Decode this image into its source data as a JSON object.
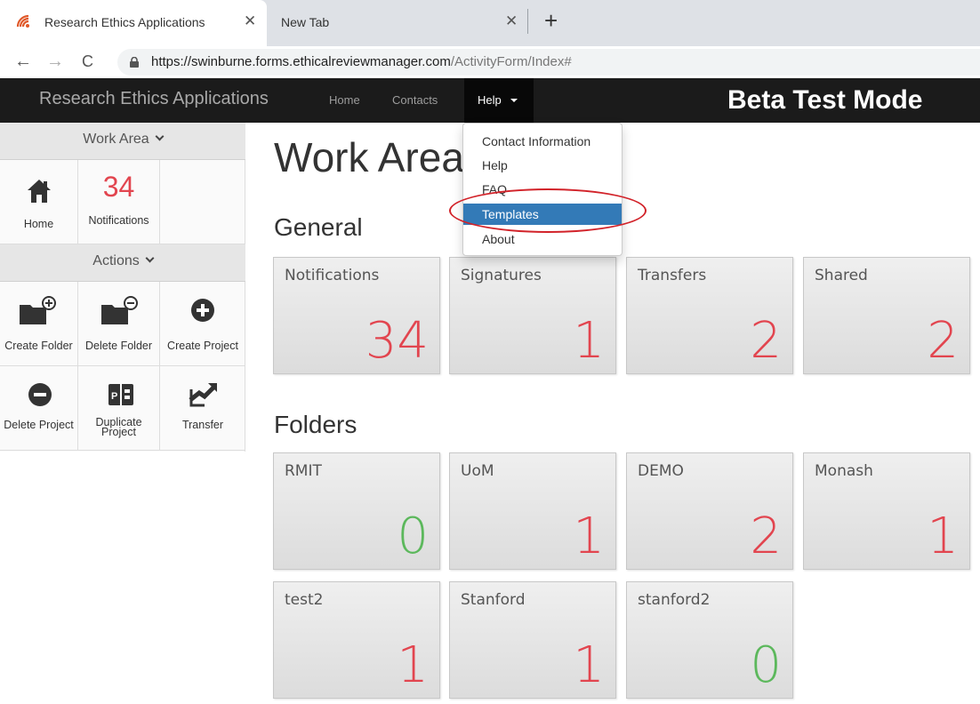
{
  "browser": {
    "tabs": [
      {
        "title": "Research Ethics Applications",
        "active": true
      },
      {
        "title": "New Tab",
        "active": false
      }
    ],
    "close_glyph": "✕",
    "new_tab_glyph": "+",
    "nav": {
      "back": "←",
      "forward": "→",
      "reload": "C"
    },
    "url_domain": "https://swinburne.forms.ethicalreviewmanager.com",
    "url_path": "/ActivityForm/Index#"
  },
  "navbar": {
    "brand": "Research Ethics Applications",
    "links": [
      "Home",
      "Contacts"
    ],
    "help_label": "Help",
    "beta_label": "Beta Test Mode"
  },
  "sidebar": {
    "work_area_heading": "Work Area",
    "work_area_items": [
      {
        "label": "Home",
        "icon": "home-icon"
      },
      {
        "label": "Notifications",
        "count": "34"
      }
    ],
    "actions_heading": "Actions",
    "actions": [
      {
        "label": "Create Folder",
        "icon": "folder-plus-icon"
      },
      {
        "label": "Delete Folder",
        "icon": "folder-minus-icon"
      },
      {
        "label": "Create Project",
        "icon": "plus-circle-icon"
      },
      {
        "label": "Delete Project",
        "icon": "minus-circle-icon"
      },
      {
        "label_line1": "Duplicate",
        "label_line2": "Project",
        "icon": "duplicate-icon"
      },
      {
        "label": "Transfer",
        "icon": "transfer-icon"
      }
    ]
  },
  "main": {
    "title": "Work Area",
    "general_heading": "General",
    "general_tiles": [
      {
        "label": "Notifications",
        "count": "34",
        "color": "#e2454f"
      },
      {
        "label": "Signatures",
        "count": "1",
        "color": "#e2454f"
      },
      {
        "label": "Transfers",
        "count": "2",
        "color": "#e2454f"
      },
      {
        "label": "Shared",
        "count": "2",
        "color": "#e2454f"
      }
    ],
    "folders_heading": "Folders",
    "folder_tiles": [
      {
        "label": "RMIT",
        "count": "0",
        "color": "#5cb85c"
      },
      {
        "label": "UoM",
        "count": "1",
        "color": "#e2454f"
      },
      {
        "label": "DEMO",
        "count": "2",
        "color": "#e2454f"
      },
      {
        "label": "Monash",
        "count": "1",
        "color": "#e2454f"
      },
      {
        "label": "test2",
        "count": "1",
        "color": "#e2454f"
      },
      {
        "label": "Stanford",
        "count": "1",
        "color": "#e2454f"
      },
      {
        "label": "stanford2",
        "count": "0",
        "color": "#5cb85c"
      }
    ]
  },
  "help_menu": {
    "items": [
      "Contact Information",
      "Help",
      "FAQ",
      "Templates",
      "About"
    ],
    "active_item": "Templates",
    "active_color": "#337ab7",
    "annotation_color": "#d2232a"
  }
}
